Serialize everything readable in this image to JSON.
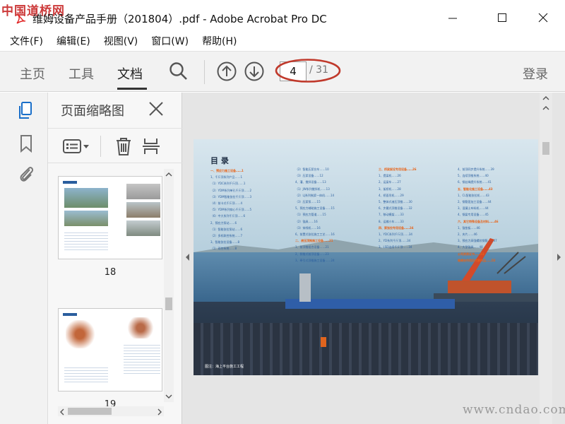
{
  "watermark": "中国道桥网",
  "window": {
    "title": "维姆设备产品手册（201804）.pdf - Adobe Acrobat Pro DC",
    "minimize_glyph": "—",
    "maximize_glyph": "☐",
    "close_glyph": "✕"
  },
  "menu": [
    "文件(F)",
    "编辑(E)",
    "视图(V)",
    "窗口(W)",
    "帮助(H)"
  ],
  "toolbar": {
    "tabs": [
      {
        "label": "主页",
        "active": false
      },
      {
        "label": "工具",
        "active": false
      },
      {
        "label": "文档",
        "active": true
      }
    ],
    "current_page": "4",
    "total_pages": "/ 31",
    "login": "登录"
  },
  "thumbnails": {
    "title": "页面缩略图",
    "pages": [
      {
        "number": "18"
      },
      {
        "number": "19"
      }
    ]
  },
  "document": {
    "toc_title": "目  录",
    "toc_caption": "图注：海上平台施工工程",
    "toc_col1": [
      "一、预应力施工设备……1",
      "1、千斤顶系列产品……1",
      "（1）YDC系列千斤顶……1",
      "（2）YDM系列单孔千斤顶……2",
      "（3）YDM智能张拉千斤顶……3",
      "（4）前卡式千斤顶……4",
      "（5）YDM系列穿心千斤顶……5",
      "（6）中大系列千斤顶……6",
      "2、预应力泵站……6",
      "（1）智能张拉泵站……6",
      "（2）多机联控系统……7",
      "3、智能张拉设备……8",
      "（1）双控系统……8"
    ],
    "toc_col2": [
      "（2）智能压浆台车……10",
      "（3）压浆设备……12",
      "4、灌、搅拌设备……13",
      "（1）JW系列搅拌机……13",
      "（2）LJ系列制浆一体机……14",
      "（3）压浆泵……15",
      "5、预应力辅助施工设备……15",
      "（1）预应力管道……15",
      "（2）锚具……16",
      "（3）穿线机……16",
      "6、前置式张拉施工工艺……16",
      "二、液压顶推施工设备……21",
      "1、前顶推组合设备……21",
      "2、侧推式前顶设备……23",
      "3、牵引式顶推施工设备……24"
    ],
    "toc_col3": [
      "三、桥梁架设专用设备……26",
      "1、提梁机……26",
      "2、运梁车……27",
      "3、架桥机……28",
      "4、桥面吊机……29",
      "5、整体式液压顶推……30",
      "6、步履式顶推设备……32",
      "7、移动模架……33",
      "8、运输小车……33",
      "四、索张拉专用设备……34",
      "1、YDC系列千斤顶……34",
      "2、YD系列千斤顶……34",
      "3、LSD连续千斤顶……34"
    ],
    "toc_col4": [
      "4、前顶同步提升系统……39",
      "5、连续顶推系统……40",
      "6、钢丝绳提升系统……41",
      "五、智能化施工设备……43",
      "1、CL智能张拉机……43",
      "2、钢筋笼加工设备……44",
      "3、混凝土布料机……44",
      "4、钢梁专用设备……45",
      "六、其它特殊设备及材料……46",
      "1、锚垫板……46",
      "2、夹片……46",
      "3、预应力高强螺纹钢筋……47",
      "4、大型锚具……48",
      "公司资质证书……51",
      "维姆合作项目代表作品……52"
    ]
  },
  "brand_watermark": "www.cndao.com",
  "colors": {
    "watermark_red": "#c41818",
    "toc_orange": "#e8641a",
    "toc_blue": "#2a5e9e",
    "callout_red": "#c0392b"
  }
}
